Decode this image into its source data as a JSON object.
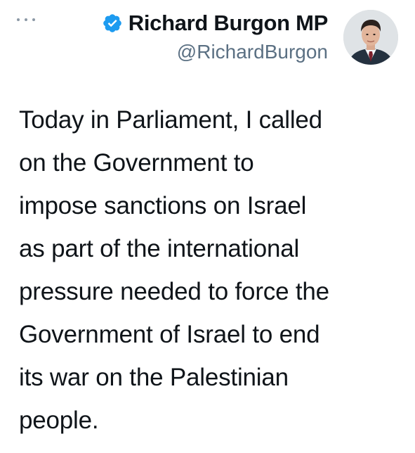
{
  "tweet": {
    "author": {
      "display_name": "Richard Burgon MP",
      "handle": "@RichardBurgon",
      "verified": true,
      "verified_icon": "verified-badge-icon",
      "avatar_icon": "avatar-portrait",
      "verified_color": "#1d9bf0"
    },
    "more_icon": "more-options-icon",
    "text": "Today in Parliament, I called\non the Government to\nimpose sanctions on Israel\nas part of the international\npressure needed to force the\nGovernment of Israel to end\nits war on the Palestinian\npeople."
  }
}
